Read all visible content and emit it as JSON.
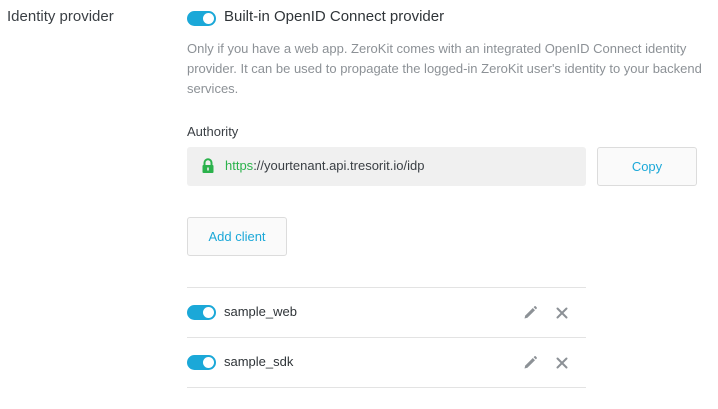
{
  "section": {
    "label": "Identity provider"
  },
  "provider": {
    "enabled": true,
    "title": "Built-in OpenID Connect provider",
    "description": "Only if you have a web app. ZeroKit comes with an integrated OpenID Connect identity provider. It can be used to propagate the logged-in ZeroKit user's identity to your backend services."
  },
  "authority": {
    "label": "Authority",
    "url_scheme": "https",
    "url_rest": "://yourtenant.api.tresorit.io/idp",
    "copy_label": "Copy"
  },
  "add_client_label": "Add client",
  "clients": [
    {
      "name": "sample_web",
      "enabled": true
    },
    {
      "name": "sample_sdk",
      "enabled": true
    }
  ],
  "colors": {
    "accent": "#1ba8d8",
    "secure": "#2bb24c"
  }
}
